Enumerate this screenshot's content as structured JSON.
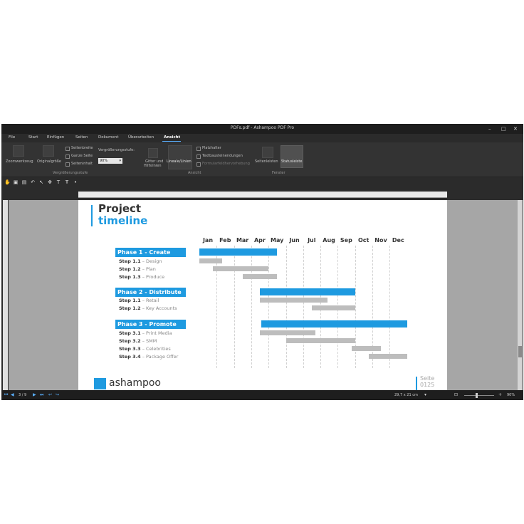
{
  "window": {
    "title": "PDFs.pdf - Ashampoo PDF Pro",
    "controls": {
      "minimize": "–",
      "restore": "□",
      "close": "✕"
    }
  },
  "menu": {
    "items": [
      "File",
      "Start",
      "Einfügen",
      "Seiten",
      "Dokument",
      "Überarbeiten",
      "Ansicht"
    ],
    "active": "Ansicht"
  },
  "ribbon": {
    "zoomtool": "Zoomwerkzeug",
    "original": "Originalgröße",
    "seitenbreite": "Seitenbreite",
    "ganze_seite": "Ganze Seite",
    "seiteninhalt": "Seiteninhalt",
    "zoom_label": "Vergrößerungsstufe:",
    "zoom_value": "90%",
    "group_zoom": "Vergrößerungsstufe",
    "gitter_1": "Gitter und",
    "gitter_2": "Hilfslinien",
    "lineale": "Lineale/Linien",
    "platzhalter": "Platzhalter",
    "textbausteine": "Textbausteinendungen",
    "formular": "Formularfeldhervorhebung",
    "group_ansicht": "Ansicht",
    "seitenleisten": "Seitenleisten",
    "statusleiste": "Statusleiste",
    "group_fenster": "Fenster"
  },
  "toolbar": {
    "icons": [
      "hand-icon",
      "save-icon",
      "print-icon",
      "undo-icon",
      "select-icon",
      "pan-icon",
      "text-icon",
      "text-edit-icon",
      "pin-icon"
    ]
  },
  "document": {
    "title": "Project",
    "subtitle": "timeline",
    "months": [
      "Jan",
      "Feb",
      "Mar",
      "Apr",
      "May",
      "Jun",
      "Jul",
      "Aug",
      "Sep",
      "Oct",
      "Nov",
      "Dec"
    ],
    "phases": [
      {
        "label": "Phase 1 - Create",
        "start": 1,
        "end": 5.5,
        "steps": [
          {
            "num": "Step 1.1",
            "name": "Design",
            "start": 1,
            "end": 2.3
          },
          {
            "num": "Step 1.2",
            "name": "Plan",
            "start": 1.8,
            "end": 5
          },
          {
            "num": "Step 1.3",
            "name": "Produce",
            "start": 3.5,
            "end": 5.5
          }
        ]
      },
      {
        "label": "Phase 2 - Distribute",
        "start": 4.5,
        "end": 10,
        "steps": [
          {
            "num": "Step 1.1",
            "name": "Retail",
            "start": 4.5,
            "end": 8.4
          },
          {
            "num": "Step 1.2",
            "name": "Key Accounts",
            "start": 7.5,
            "end": 10
          }
        ]
      },
      {
        "label": "Phase 3 - Promote",
        "start": 4.6,
        "end": 13,
        "steps": [
          {
            "num": "Step 3.1",
            "name": "Print Media",
            "start": 4.5,
            "end": 7.7
          },
          {
            "num": "Step 3.2",
            "name": "SMM",
            "start": 6.0,
            "end": 10.0
          },
          {
            "num": "Step 3.3",
            "name": "Celebrities",
            "start": 9.8,
            "end": 11.5
          },
          {
            "num": "Step 3.4",
            "name": "Package Offer",
            "start": 10.8,
            "end": 13
          }
        ]
      }
    ],
    "logo": "ashampoo",
    "page_label": "Seite",
    "page_number": "0125",
    "accent": "#1e9ae0",
    "step_bar": "#bdbdbd"
  },
  "status": {
    "page": "3 / 9",
    "size": "29,7 x 21 cm",
    "zoom": "90%"
  }
}
